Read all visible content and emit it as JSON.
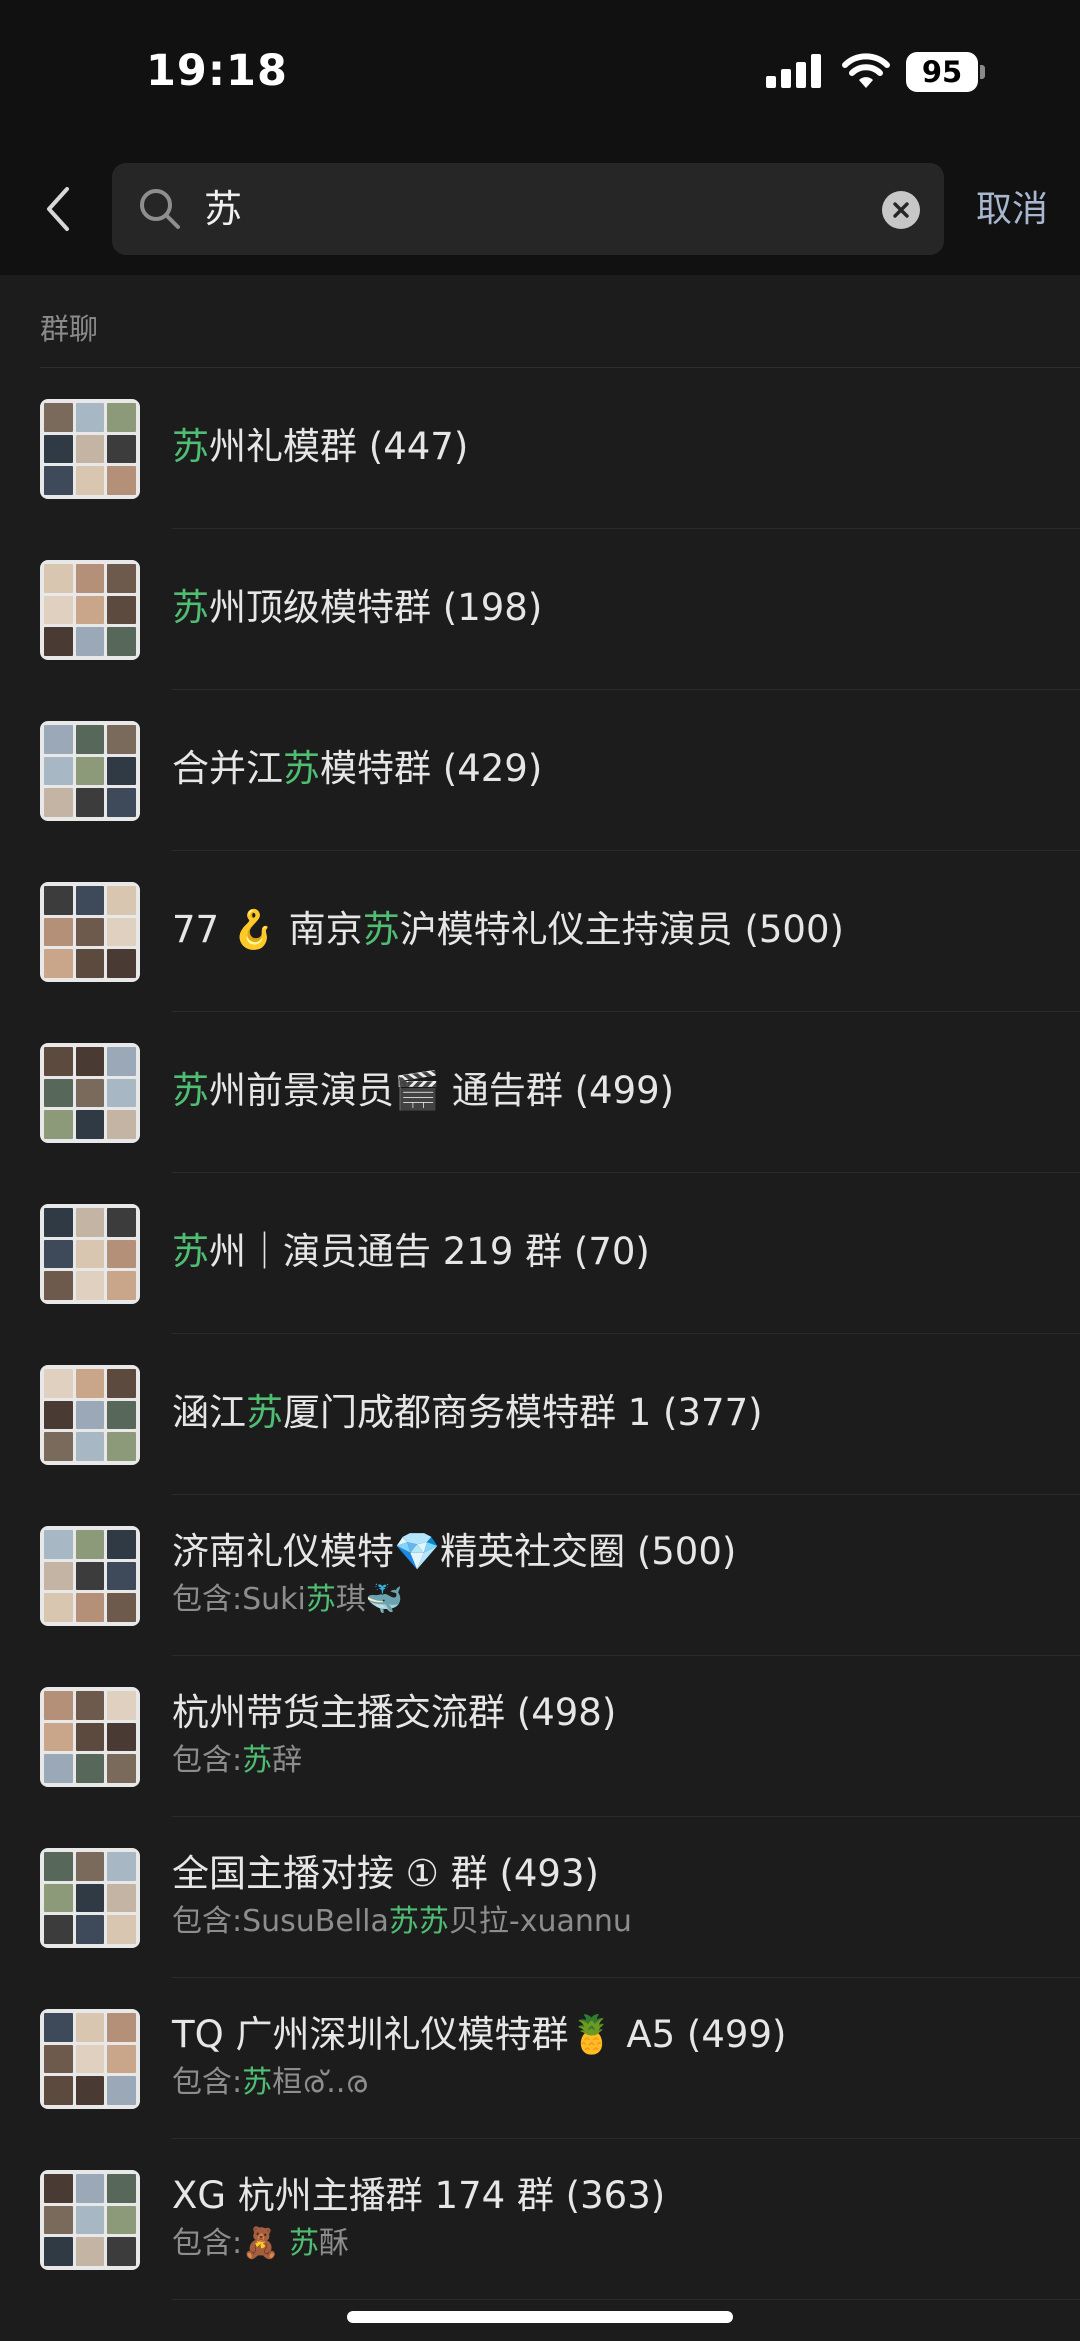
{
  "status_bar": {
    "time": "19:18",
    "battery": "95"
  },
  "search": {
    "query": "苏",
    "cancel_label": "取消"
  },
  "section": {
    "title": "群聊"
  },
  "groups": [
    {
      "pre": "",
      "hl": "苏",
      "post": "州礼模群 (447)",
      "sub": null
    },
    {
      "pre": "",
      "hl": "苏",
      "post": "州顶级模特群 (198)",
      "sub": null
    },
    {
      "pre": "合并江",
      "hl": "苏",
      "post": "模特群 (429)",
      "sub": null
    },
    {
      "pre": "77 🪝 南京",
      "hl": "苏",
      "post": "沪模特礼仪主持演员 (500)",
      "sub": null
    },
    {
      "pre": "",
      "hl": "苏",
      "post": "州前景演员🎬 通告群 (499)",
      "sub": null
    },
    {
      "pre": "",
      "hl": "苏",
      "post": "州｜演员通告 219 群 (70)",
      "sub": null
    },
    {
      "pre": "涵江",
      "hl": "苏",
      "post": "厦门成都商务模特群 1 (377)",
      "sub": null
    },
    {
      "pre": "济南礼仪模特💎精英社交圈 (500)",
      "hl": "",
      "post": "",
      "sub": {
        "pre": "包含:Suki",
        "hl": "苏",
        "post": "琪🐳"
      }
    },
    {
      "pre": "杭州带货主播交流群 (498)",
      "hl": "",
      "post": "",
      "sub": {
        "pre": "包含:",
        "hl": "苏",
        "post": "辞"
      }
    },
    {
      "pre": "全国主播对接 ① 群 (493)",
      "hl": "",
      "post": "",
      "sub": {
        "pre": "包含:SusuBella",
        "hl": "苏苏",
        "post": "贝拉-xuannu"
      }
    },
    {
      "pre": "TQ 广州深圳礼仪模特群🍍 A5 (499)",
      "hl": "",
      "post": "",
      "sub": {
        "pre": "包含:",
        "hl": "苏",
        "post": "桓ര്..ര"
      }
    },
    {
      "pre": "XG 杭州主播群 174 群 (363)",
      "hl": "",
      "post": "",
      "sub": {
        "pre": "包含:🧸 ",
        "hl": "苏",
        "post": "酥"
      }
    }
  ],
  "colors": {
    "highlight": "#4fbd72",
    "background": "#1c1c1c",
    "header": "#111111",
    "cancel": "#a8b7cf"
  }
}
